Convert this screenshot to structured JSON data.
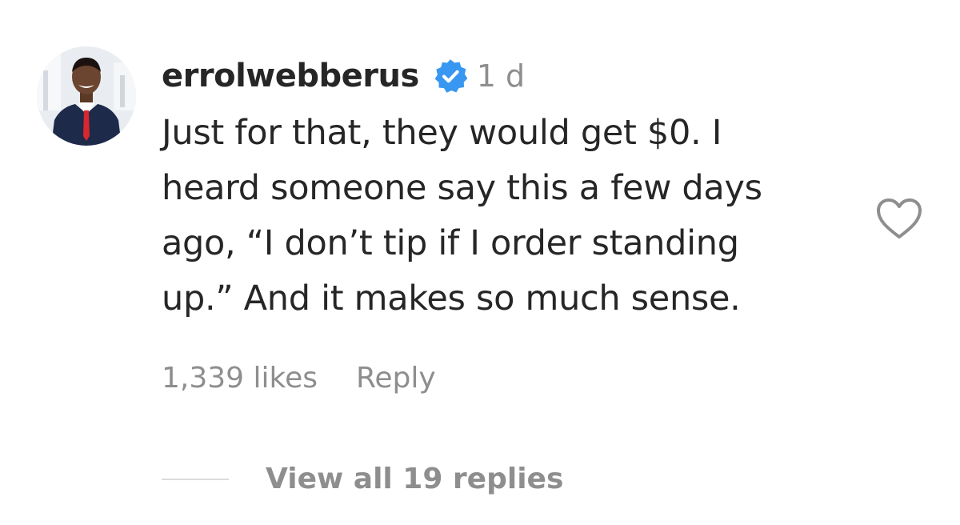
{
  "comment": {
    "username": "errolwebberus",
    "verified_icon": "verified-badge-icon",
    "timestamp": "1 d",
    "text": "Just for that, they would get $0. I\nheard someone say this a few days\nago, “I don’t tip if I order standing\nup.” And it makes so much sense.",
    "likes": "1,339 likes",
    "reply_label": "Reply",
    "like_icon": "heart-outline-icon",
    "view_replies": "View all 19 replies"
  },
  "colors": {
    "text_primary": "#262626",
    "text_secondary": "#8e8e8e",
    "verified_blue": "#3897f0",
    "divider": "#dbdbdb"
  }
}
